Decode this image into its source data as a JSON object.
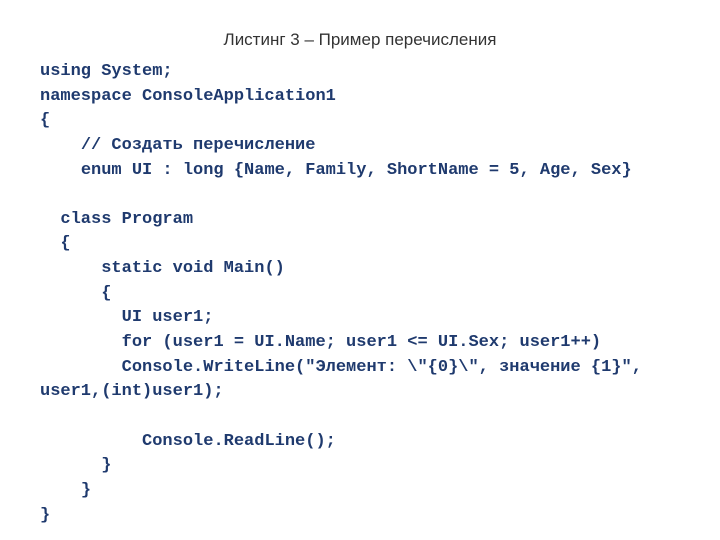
{
  "title": "Листинг 3 – Пример перечисления",
  "code": "using System;\nnamespace ConsoleApplication1\n{\n    // Создать перечисление\n    enum UI : long {Name, Family, ShortName = 5, Age, Sex}\n\n  class Program\n  {\n      static void Main()\n      {\n        UI user1;\n        for (user1 = UI.Name; user1 <= UI.Sex; user1++)\n        Console.WriteLine(\"Элемент: \\\"{0}\\\", значение {1}\",\nuser1,(int)user1);\n\n          Console.ReadLine();\n      }\n    }\n}"
}
